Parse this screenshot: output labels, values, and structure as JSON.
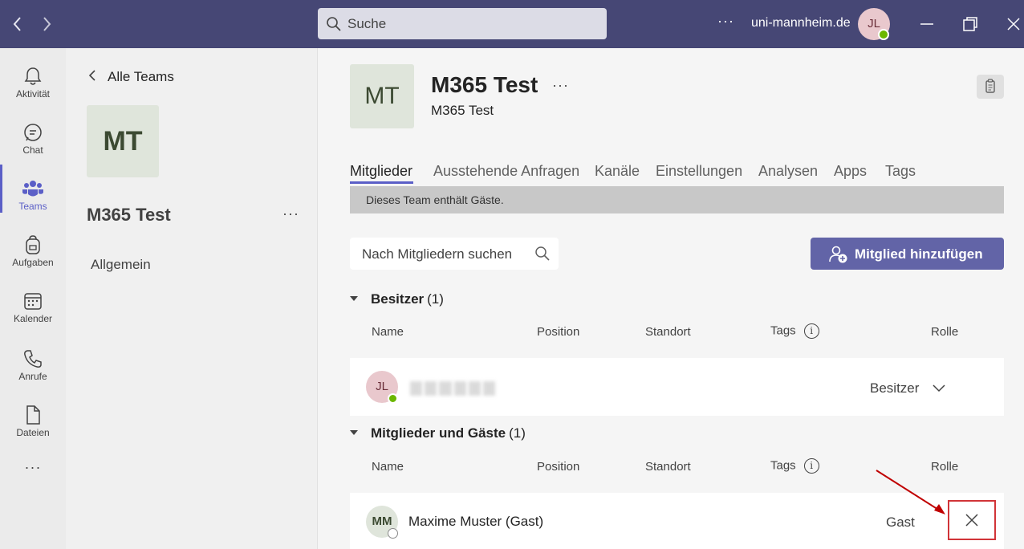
{
  "titlebar": {
    "search_placeholder": "Suche",
    "tenant": "uni-mannheim.de",
    "user_initials": "JL",
    "more_label": "···",
    "nav_back": "‹",
    "nav_forward": "›"
  },
  "rail": {
    "items": [
      {
        "label": "Aktivität",
        "icon": "bell-icon"
      },
      {
        "label": "Chat",
        "icon": "chat-icon"
      },
      {
        "label": "Teams",
        "icon": "teams-icon",
        "active": true
      },
      {
        "label": "Aufgaben",
        "icon": "backpack-icon"
      },
      {
        "label": "Kalender",
        "icon": "calendar-icon"
      },
      {
        "label": "Anrufe",
        "icon": "phone-icon"
      },
      {
        "label": "Dateien",
        "icon": "file-icon"
      }
    ],
    "more": "···"
  },
  "teampanel": {
    "back_label": "Alle Teams",
    "tile_initials": "MT",
    "team_name": "M365 Test",
    "more": "···",
    "channels": [
      "Allgemein"
    ]
  },
  "main": {
    "tile_initials": "MT",
    "title": "M365 Test",
    "title_more": "···",
    "subtitle": "M365 Test",
    "tabs": [
      "Mitglieder",
      "Ausstehende Anfragen",
      "Kanäle",
      "Einstellungen",
      "Analysen",
      "Apps",
      "Tags"
    ],
    "guest_banner": "Dieses Team enthält Gäste.",
    "member_search_placeholder": "Nach Mitgliedern suchen",
    "add_member_label": "Mitglied hinzufügen",
    "columns": {
      "name": "Name",
      "position": "Position",
      "location": "Standort",
      "tags": "Tags",
      "role": "Rolle",
      "info": "i"
    },
    "owners": {
      "title": "Besitzer",
      "count": "(1)",
      "rows": [
        {
          "initials": "JL",
          "name": "",
          "role": "Besitzer"
        }
      ]
    },
    "members": {
      "title": "Mitglieder und Gäste",
      "count": "(1)",
      "rows": [
        {
          "initials": "MM",
          "name": "Maxime Muster (Gast)",
          "role": "Gast"
        }
      ]
    }
  },
  "colors": {
    "titlebar": "#464775",
    "accent": "#6264a7",
    "highlight": "#d13438",
    "presence_available": "#6bb700"
  }
}
